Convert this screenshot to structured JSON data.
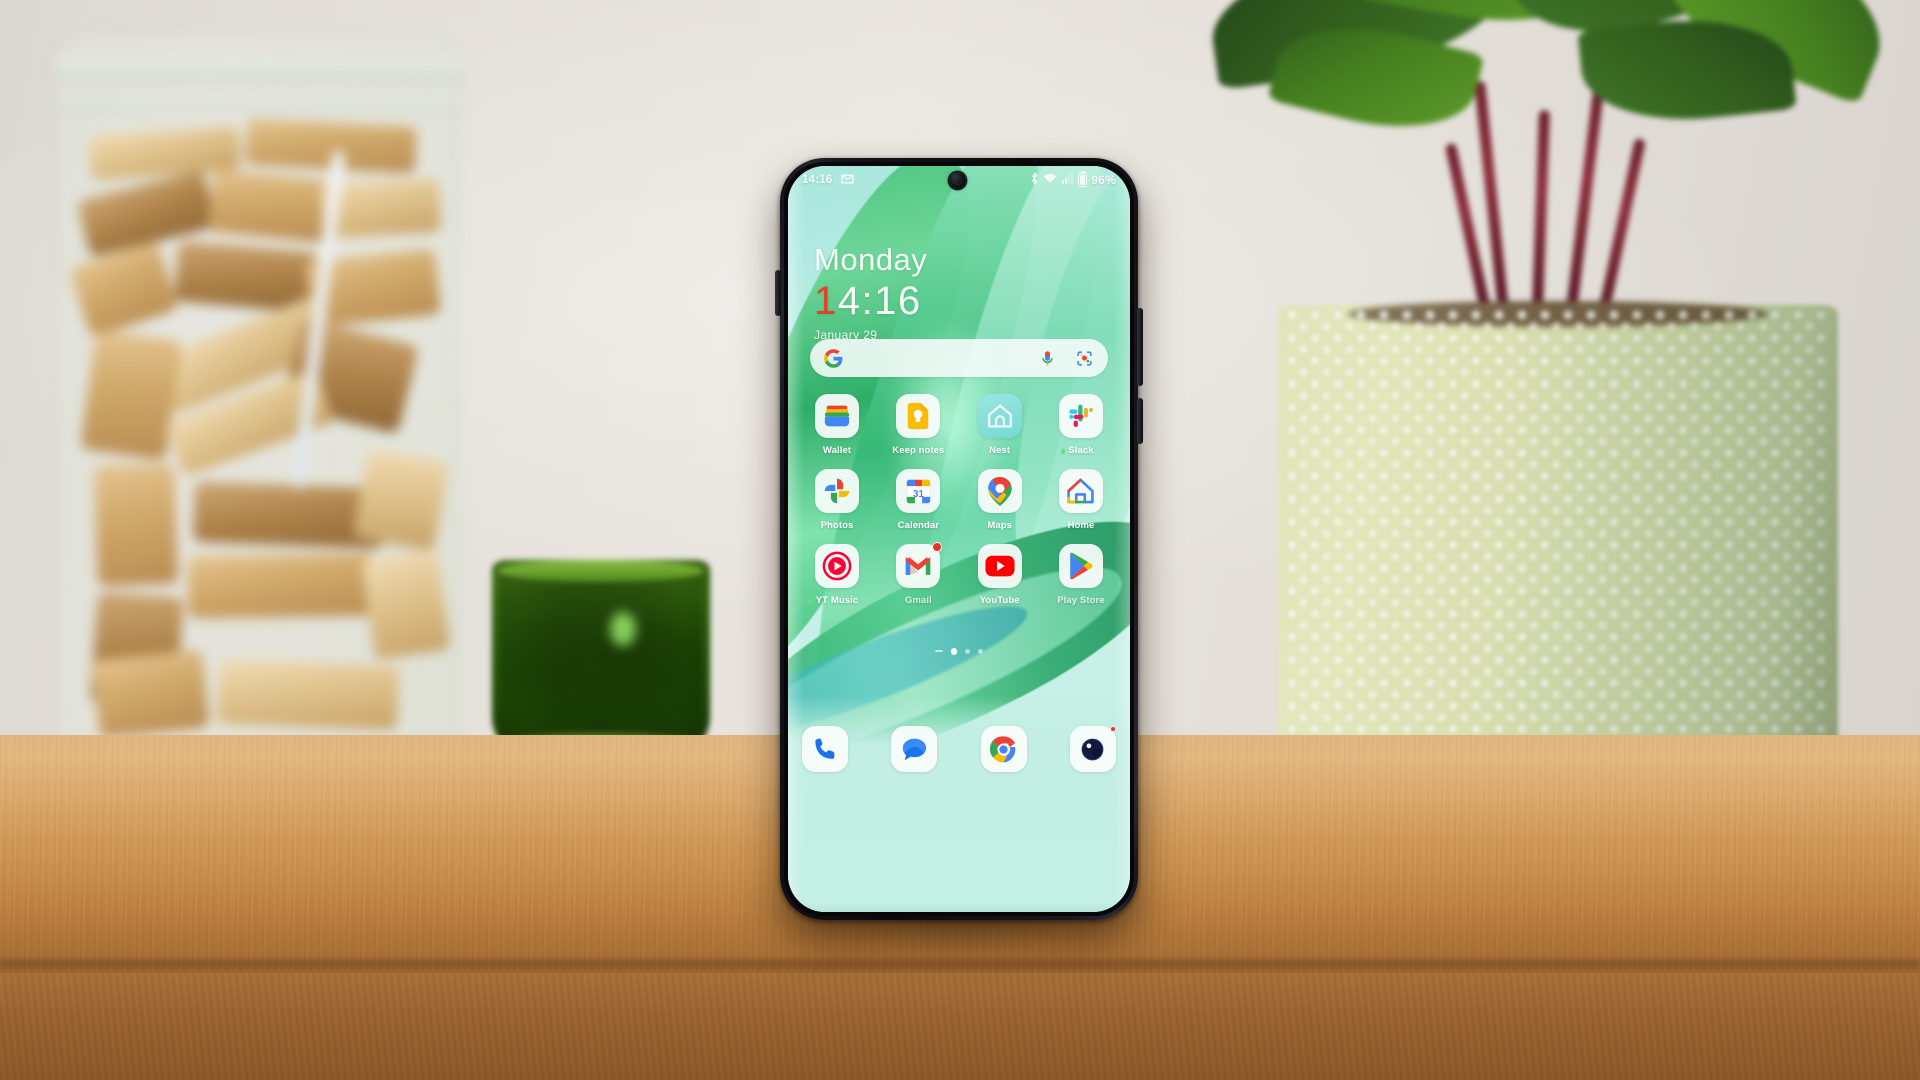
{
  "scene": {
    "description": "Smartphone standing on a wooden table showing an Android home screen",
    "objects": {
      "cork_jar": "glass-jar-with-wine-corks",
      "votive": "green-textured-glass-votive",
      "plant_pot": "light-green-dotted-ceramic-pot",
      "plant": "dark-leafed-houseplant",
      "table": "wooden-table",
      "wall": "light-beige-wall"
    }
  },
  "phone": {
    "status_bar": {
      "time": "14:16",
      "notification_icons": [
        "gmail-icon"
      ],
      "system_icons": [
        "bluetooth-icon",
        "wifi-icon",
        "signal-icon",
        "battery-icon"
      ],
      "battery_percent": "96%"
    },
    "clock_widget": {
      "day": "Monday",
      "time_first_digit": "1",
      "time_rest": "4:16",
      "date": "January 29"
    },
    "search": {
      "placeholder": "",
      "value": "",
      "logo": "google-g-icon",
      "mic": "microphone-icon",
      "lens": "google-lens-icon"
    },
    "app_grid": [
      [
        {
          "label": "Wallet",
          "icon": "google-wallet-icon",
          "badge": false,
          "dot": false
        },
        {
          "label": "Keep notes",
          "icon": "google-keep-icon",
          "badge": false,
          "dot": false
        },
        {
          "label": "Nest",
          "icon": "google-nest-icon",
          "badge": false,
          "dot": false
        },
        {
          "label": "Slack",
          "icon": "slack-icon",
          "badge": false,
          "dot": true
        }
      ],
      [
        {
          "label": "Photos",
          "icon": "google-photos-icon",
          "badge": false,
          "dot": false
        },
        {
          "label": "Calendar",
          "icon": "google-calendar-icon",
          "badge": false,
          "dot": false,
          "day_number": "31"
        },
        {
          "label": "Maps",
          "icon": "google-maps-icon",
          "badge": false,
          "dot": false
        },
        {
          "label": "Home",
          "icon": "google-home-icon",
          "badge": false,
          "dot": false
        }
      ],
      [
        {
          "label": "YT Music",
          "icon": "youtube-music-icon",
          "badge": false,
          "dot": true
        },
        {
          "label": "Gmail",
          "icon": "gmail-icon",
          "badge": true,
          "dot": false
        },
        {
          "label": "YouTube",
          "icon": "youtube-icon",
          "badge": false,
          "dot": false
        },
        {
          "label": "Play Store",
          "icon": "google-play-icon",
          "badge": false,
          "dot": false
        }
      ]
    ],
    "page_indicator": {
      "pages": 3,
      "active_index": 0,
      "has_leading_dash": true
    },
    "dock": [
      {
        "name": "Phone",
        "icon": "phone-icon",
        "badge": false
      },
      {
        "name": "Messages",
        "icon": "messages-icon",
        "badge": false
      },
      {
        "name": "Chrome",
        "icon": "chrome-icon",
        "badge": false
      },
      {
        "name": "Camera",
        "icon": "camera-icon",
        "badge": true
      }
    ]
  },
  "colors": {
    "wallpaper_base": "#c4efe4",
    "wallpaper_green": "#2ea86c",
    "clock_accent": "#e4402a",
    "badge_red": "#ea3323",
    "dot_green": "#5ee08a",
    "table_wood": "#c98c47",
    "pot_green": "#d6ddaa"
  }
}
